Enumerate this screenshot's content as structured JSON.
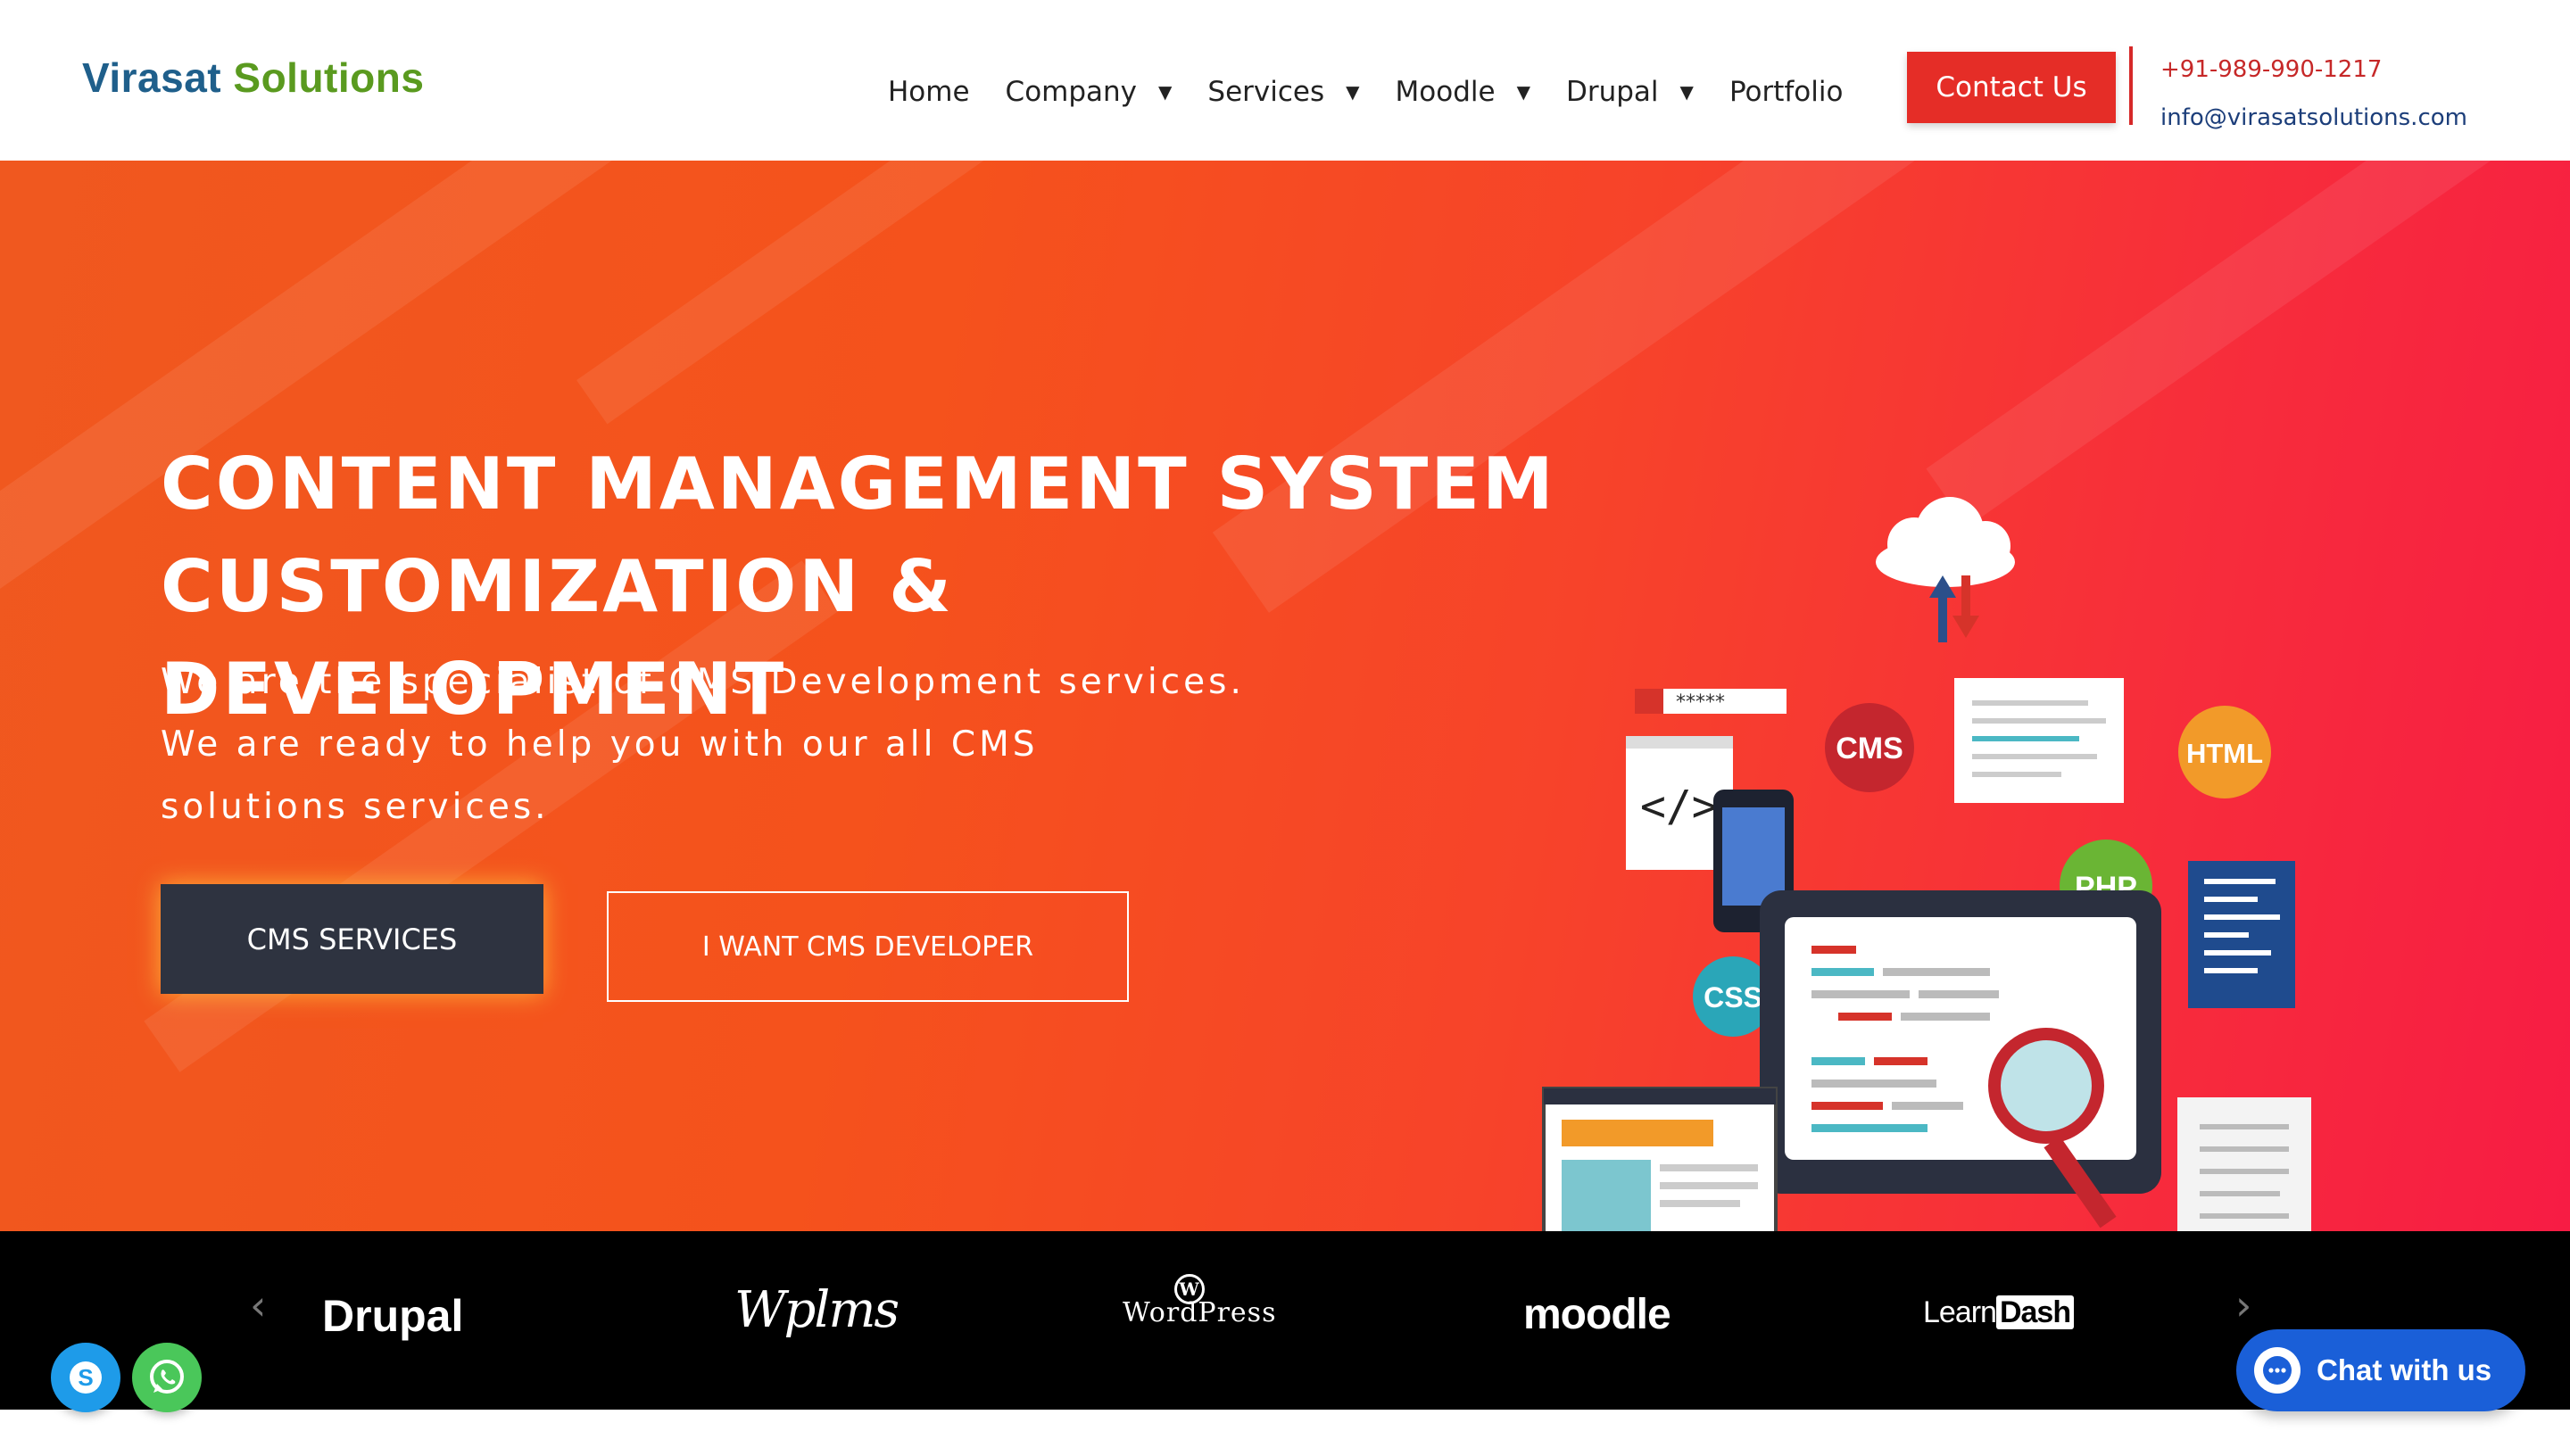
{
  "header": {
    "logo": {
      "word1": "Virasat",
      "word2": "Solutions"
    },
    "nav": [
      {
        "label": "Home"
      },
      {
        "label": "Company"
      },
      {
        "label": "Services"
      },
      {
        "label": "Moodle"
      },
      {
        "label": "Drupal"
      },
      {
        "label": "Portfolio"
      }
    ],
    "caret": "▼",
    "contact_button": "Contact Us",
    "phone": "+91-989-990-1217",
    "email": "info@virasatsolutions.com"
  },
  "hero": {
    "title_line1": "CONTENT MANAGEMENT SYSTEM",
    "title_line2": "CUSTOMIZATION & DEVELOPMENT",
    "desc_line1": "We are the specialist of CMS Development services.",
    "desc_line2": "We are ready to help you with our all CMS",
    "desc_line3": "solutions services.",
    "primary_button": "CMS SERVICES",
    "secondary_button": "I WANT CMS DEVELOPER",
    "illustration": {
      "badges": [
        "CMS",
        "HTML",
        "PHP",
        "CSS"
      ],
      "password_mask": "*****",
      "code_glyph": "</>"
    }
  },
  "logo_strip": {
    "prev_arrow": "‹",
    "next_arrow": "›",
    "brands": {
      "drupal": "Drupal",
      "wplms": "Wplms",
      "wp_mark": "W",
      "wordpress": "WordPress",
      "moodle": "moodle",
      "learn": "Learn",
      "dash": "Dash"
    }
  },
  "chat": {
    "label": "Chat with us"
  },
  "colors": {
    "brand_blue": "#1f5f8b",
    "brand_green": "#5a9a1f",
    "accent_red": "#e52d27",
    "hero_start": "#f0581f",
    "hero_end": "#f71c44",
    "button_dark": "#2e3340",
    "chat_blue": "#1a5fd8",
    "skype_blue": "#1e9be9",
    "whatsapp_green": "#4ac75a"
  },
  "icons": [
    "caret-down-icon",
    "chevron-left-icon",
    "chevron-right-icon",
    "skype-icon",
    "whatsapp-icon",
    "chat-bubble-icon",
    "cloud-icon"
  ]
}
